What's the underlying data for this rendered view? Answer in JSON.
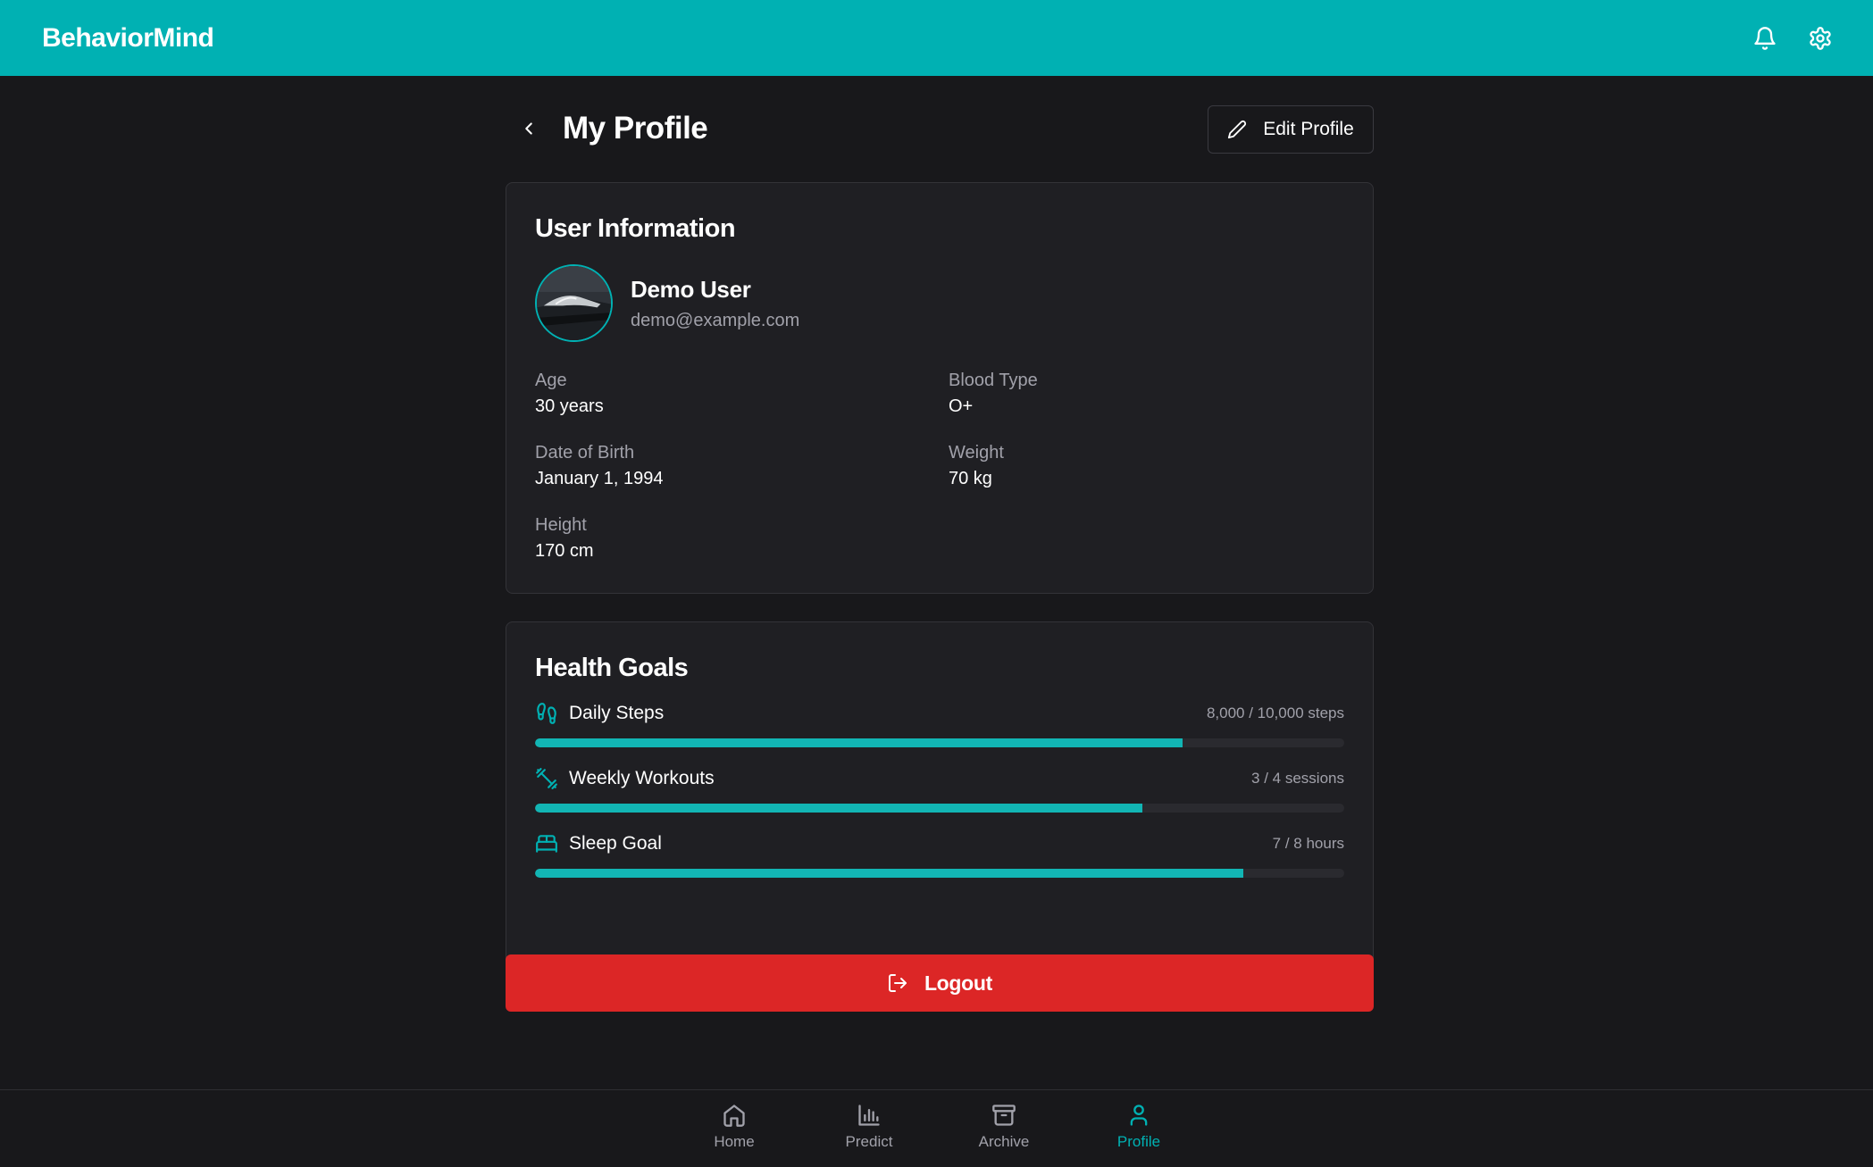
{
  "app": {
    "brand": "BehaviorMind",
    "accent": "#00b1b3",
    "danger": "#dc2626"
  },
  "topbar": {
    "icons": [
      "bell-icon",
      "gear-icon"
    ]
  },
  "header": {
    "title": "My Profile",
    "edit_label": "Edit Profile"
  },
  "user_info": {
    "title": "User Information",
    "name": "Demo User",
    "email": "demo@example.com",
    "fields": [
      {
        "label": "Age",
        "value": "30 years"
      },
      {
        "label": "Blood Type",
        "value": "O+"
      },
      {
        "label": "Date of Birth",
        "value": "January 1, 1994"
      },
      {
        "label": "Weight",
        "value": "70 kg"
      },
      {
        "label": "Height",
        "value": "170 cm"
      }
    ]
  },
  "health_goals": {
    "title": "Health Goals",
    "goals": [
      {
        "name": "Daily Steps",
        "value": "8,000 / 10,000 steps",
        "progress": 0.8,
        "icon": "footprints-icon"
      },
      {
        "name": "Weekly Workouts",
        "value": "3 / 4 sessions",
        "progress": 0.75,
        "icon": "dumbbell-icon"
      },
      {
        "name": "Sleep Goal",
        "value": "7 / 8 hours",
        "progress": 0.875,
        "icon": "bed-icon"
      }
    ]
  },
  "logout_label": "Logout",
  "bottom_nav": {
    "items": [
      {
        "label": "Home",
        "icon": "home-icon"
      },
      {
        "label": "Predict",
        "icon": "bar-chart-icon"
      },
      {
        "label": "Archive",
        "icon": "archive-icon"
      },
      {
        "label": "Profile",
        "icon": "user-icon",
        "active": true
      }
    ]
  }
}
